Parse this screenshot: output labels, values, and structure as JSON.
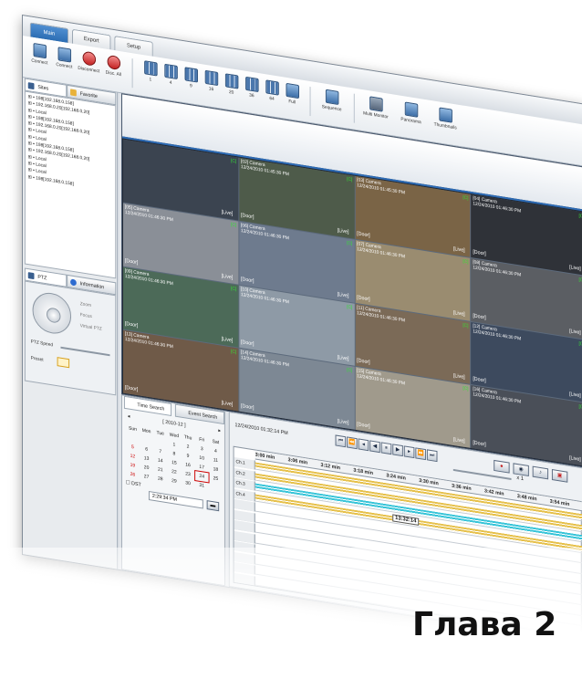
{
  "tabs": [
    "Main",
    "Export",
    "Setup"
  ],
  "toolbar": {
    "buttons": [
      "Connect",
      "Connect",
      "Disconnect",
      "Disc. All"
    ],
    "layouts": [
      "1",
      "4",
      "9",
      "16",
      "20",
      "36",
      "64",
      "Full"
    ],
    "actions": [
      "Sequence",
      "Multi Monitor",
      "Panorama",
      "Thumbnails"
    ]
  },
  "panel": {
    "tab_sites": "Sites",
    "tab_favorite": "Favorite",
    "tree": [
      "198[192.168.0.158]",
      "192.168.0.20[192.168.0.20]",
      "Local",
      "198[192.168.0.158]",
      "192.168.0.20[192.168.0.20]",
      "Local",
      "Local",
      "198[192.168.0.158]",
      "192.168.0.20[192.168.0.20]",
      "Local",
      "Local",
      "Local",
      "198[192.168.0.158]"
    ],
    "tab_ptz": "PTZ",
    "tab_info": "Information",
    "ptz": {
      "zoom": "Zoom",
      "focus": "Focus",
      "virtual": "Virtual PTZ",
      "speed": "PTZ Speed",
      "preset": "Preset"
    }
  },
  "cameras": [
    {
      "label": "",
      "time": "",
      "overlay": "[Live]",
      "door": "",
      "bg": "#3b4450"
    },
    {
      "label": "[02] Camera",
      "time": "12/24/2010 01:45:30 PM",
      "overlay": "[Live]",
      "door": "[Door]",
      "bg": "#4e5b4a"
    },
    {
      "label": "[03] Camera",
      "time": "12/24/2010 01:45:30 PM",
      "overlay": "[Live]",
      "door": "[Door]",
      "bg": "#7a6446"
    },
    {
      "label": "[04] Camera",
      "time": "12/24/2010 01:46:30 PM",
      "overlay": "[Live]",
      "door": "[Door]",
      "bg": "#2f3238"
    },
    {
      "label": "[05] Camera",
      "time": "12/24/2010 01:46:30 PM",
      "overlay": "[Live]",
      "door": "[Door]",
      "bg": "#8a8f97"
    },
    {
      "label": "[06] Camera",
      "time": "12/24/2010 01:46:30 PM",
      "overlay": "[Live]",
      "door": "[Door]",
      "bg": "#6e7b8e"
    },
    {
      "label": "[07] Camera",
      "time": "12/24/2010 01:46:30 PM",
      "overlay": "[Live]",
      "door": "[Door]",
      "bg": "#9a8c70"
    },
    {
      "label": "[08] Camera",
      "time": "12/24/2010 01:46:30 PM",
      "overlay": "[Live]",
      "door": "[Door]",
      "bg": "#5b5e63"
    },
    {
      "label": "[09] Camera",
      "time": "12/24/2010 01:46:30 PM",
      "overlay": "[Live]",
      "door": "[Door]",
      "bg": "#4c6a58"
    },
    {
      "label": "[10] Camera",
      "time": "12/24/2010 01:46:30 PM",
      "overlay": "[Live]",
      "door": "[Door]",
      "bg": "#8e9aa6"
    },
    {
      "label": "[11] Camera",
      "time": "12/24/2010 01:46:30 PM",
      "overlay": "[Live]",
      "door": "[Door]",
      "bg": "#7b6a57"
    },
    {
      "label": "[12] Camera",
      "time": "12/24/2010 01:46:30 PM",
      "overlay": "[Live]",
      "door": "[Door]",
      "bg": "#3d4a5e"
    },
    {
      "label": "[13] Camera",
      "time": "12/24/2010 01:46:30 PM",
      "overlay": "[Live]",
      "door": "[Door]",
      "bg": "#6f5a48"
    },
    {
      "label": "[14] Camera",
      "time": "12/24/2010 01:46:30 PM",
      "overlay": "[Live]",
      "door": "[Door]",
      "bg": "#7d8894"
    },
    {
      "label": "[15] Camera",
      "time": "12/24/2010 01:46:30 PM",
      "overlay": "[Live]",
      "door": "[Door]",
      "bg": "#a09a8c"
    },
    {
      "label": "[16] Camera",
      "time": "12/24/2010 01:46:30 PM",
      "overlay": "[Live]",
      "door": "[Door]",
      "bg": "#4a4f58"
    }
  ],
  "search": {
    "tab_time": "Time Search",
    "tab_event": "Event Search",
    "month": "[ 2010-12 ]",
    "weekdays": [
      "Sun",
      "Mon",
      "Tue",
      "Wed",
      "Thu",
      "Fri",
      "Sat"
    ],
    "weeks": [
      [
        "",
        "",
        "",
        "1",
        "2",
        "3",
        "4"
      ],
      [
        "5",
        "6",
        "7",
        "8",
        "9",
        "10",
        "11"
      ],
      [
        "12",
        "13",
        "14",
        "15",
        "16",
        "17",
        "18"
      ],
      [
        "19",
        "20",
        "21",
        "22",
        "23",
        "24",
        "25"
      ],
      [
        "26",
        "27",
        "28",
        "29",
        "30",
        "31",
        ""
      ]
    ],
    "today": "24",
    "dst": "DST",
    "time_value": "2:29:34 PM",
    "datetime": "12/24/2010 01:32:14 PM"
  },
  "timeline": {
    "ticks": [
      "3:00 min",
      "3:06 min",
      "3:12 min",
      "3:18 min",
      "3:24 min",
      "3:30 min",
      "3:36 min",
      "3:42 min",
      "3:48 min",
      "3:54 min"
    ],
    "channels": [
      "Ch.1",
      "Ch.2",
      "Ch.3",
      "Ch.4"
    ],
    "marker": "13:32:14",
    "speed": "x 1"
  },
  "chapter_title": "Глава 2"
}
